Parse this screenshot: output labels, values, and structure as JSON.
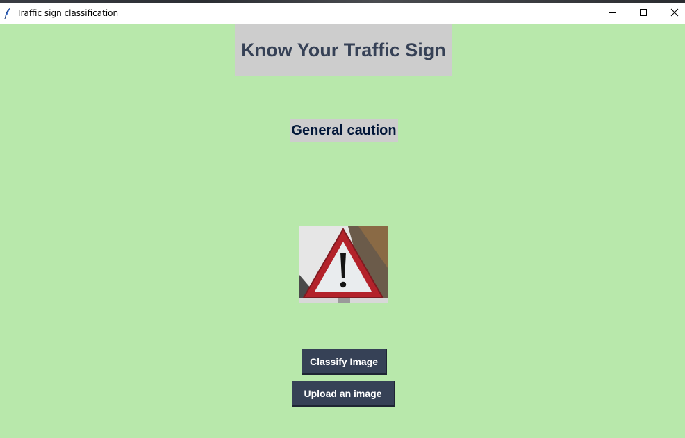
{
  "window": {
    "title": "Traffic sign classification",
    "icon": "feather-icon",
    "controls": [
      "minimize-icon",
      "maximize-icon",
      "close-icon"
    ]
  },
  "main": {
    "heading": "Know Your Traffic Sign",
    "prediction": "General caution",
    "image": {
      "description_icon": "general-caution-sign"
    },
    "buttons": {
      "classify": "Classify Image",
      "upload": "Upload an image"
    }
  },
  "colors": {
    "background": "#b8e8ab",
    "label_background": "#cdcdcd",
    "heading_text": "#364156",
    "prediction_text": "#011638",
    "button_background": "#364156",
    "button_text": "#ffffff"
  }
}
